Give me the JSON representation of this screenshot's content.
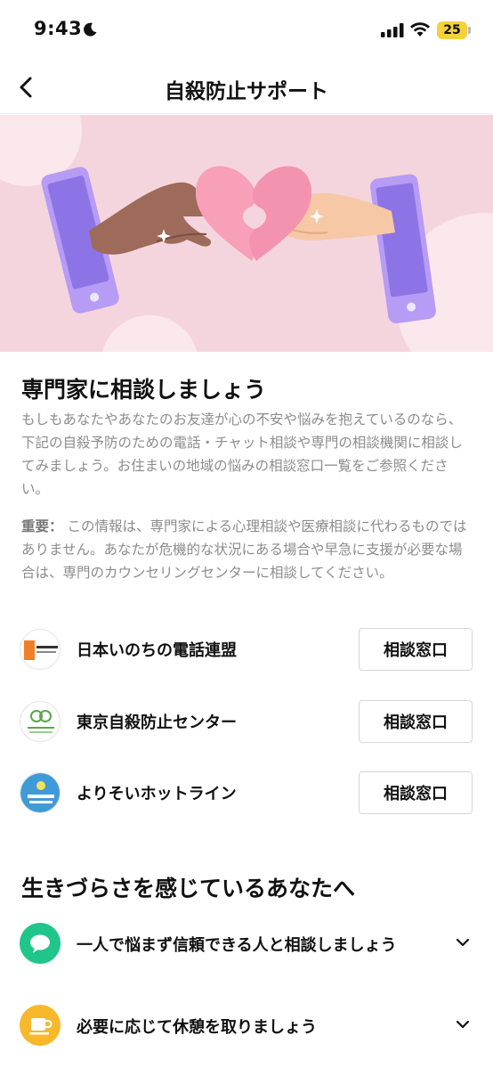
{
  "status_bar": {
    "time": "9:43",
    "battery": "25"
  },
  "nav": {
    "title": "自殺防止サポート"
  },
  "section1": {
    "title": "専門家に相談しましょう",
    "description": "もしもあなたやあなたのお友達が心の不安や悩みを抱えているのなら、下記の自殺予防のための電話・チャット相談や専門の相談機関に相談してみましょう。お住まいの地域の悩みの相談窓口一覧をご参照ください。",
    "important_label": "重要：",
    "important_text": " この情報は、専門家による心理相談や医療相談に代わるものではありません。あなたが危機的な状況にある場合や早急に支援が必要な場合は、専門のカウンセリングセンターに相談してください。",
    "organizations": [
      {
        "name": "日本いのちの電話連盟",
        "button_label": "相談窓口"
      },
      {
        "name": "東京自殺防止センター",
        "button_label": "相談窓口"
      },
      {
        "name": "よりそいホットライン",
        "button_label": "相談窓口"
      }
    ]
  },
  "section2": {
    "title": "生きづらさを感じているあなたへ",
    "tips": [
      {
        "label": "一人で悩まず信頼できる人と相談しましょう",
        "icon": "chat-bubble-icon",
        "color": "#20c58a"
      },
      {
        "label": "必要に応じて休憩を取りましょう",
        "icon": "coffee-cup-icon",
        "color": "#f7b82b"
      }
    ]
  },
  "colors": {
    "hero_background": "#f5d5dd",
    "heart": "#f7a0b8",
    "phone": "#b69cf5"
  }
}
